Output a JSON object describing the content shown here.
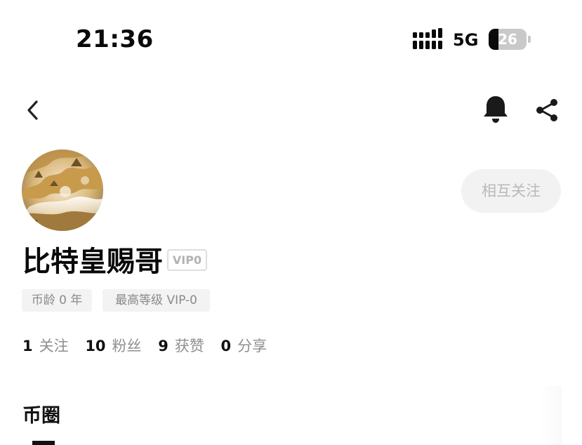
{
  "status_bar": {
    "time": "21:36",
    "network": "5G",
    "battery_level": "26",
    "signal_icon": "signal-bars-icon"
  },
  "nav": {
    "back_icon": "chevron-left-icon",
    "bell_icon": "bell-icon",
    "share_icon": "share-icon"
  },
  "profile": {
    "avatar_description_icon": "avatar-image",
    "username": "比特皇赐哥",
    "vip_badge": "VIP0",
    "mutual_follow_label": "相互关注",
    "tags": {
      "coin_age": "币龄 0 年",
      "max_level": "最高等级 VIP-0"
    },
    "stats": [
      {
        "value": "1",
        "label": "关注"
      },
      {
        "value": "10",
        "label": "粉丝"
      },
      {
        "value": "9",
        "label": "获赞"
      },
      {
        "value": "0",
        "label": "分享"
      }
    ]
  },
  "section": {
    "title": "币圈"
  },
  "colors": {
    "text_primary": "#111111",
    "text_secondary": "#8f8f8f",
    "button_bg": "#f2f2f2",
    "button_text": "#b9b9b9",
    "badge_border": "#dedede"
  }
}
